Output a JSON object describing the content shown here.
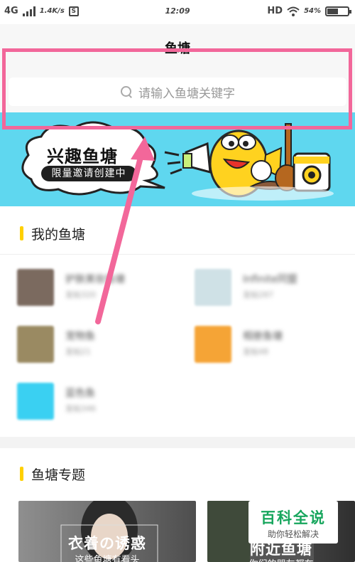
{
  "status_bar": {
    "network": "4G",
    "speed": "1.4K/s",
    "sim_icon": "S",
    "time": "12:09",
    "hd": "HD",
    "battery_text": "54%",
    "battery_level": 0.54
  },
  "header": {
    "title": "鱼塘",
    "search_placeholder": "请输入鱼塘关键字"
  },
  "banner": {
    "title": "兴趣鱼塘",
    "subtitle": "限量邀请创建中"
  },
  "my_ponds": {
    "heading": "我的鱼塘",
    "items": [
      {
        "name": "护肤美妆鱼塘",
        "meta": "发帖320",
        "thumb_color": "#7b6a5f"
      },
      {
        "name": "Infinite同盟",
        "meta": "发帖287",
        "thumb_color": "#cfe1e6"
      },
      {
        "name": "宠物鱼",
        "meta": "发帖21",
        "thumb_color": "#9a8a62"
      },
      {
        "name": "相册鱼塘",
        "meta": "发帖48",
        "thumb_color": "#f5a436"
      },
      {
        "name": "蓝色鱼",
        "meta": "发帖346",
        "thumb_color": "#3ad0f2"
      }
    ]
  },
  "topics": {
    "heading": "鱼塘专题",
    "items": [
      {
        "title": "衣着の诱惑",
        "subtitle": "这些鱼塘有看头"
      },
      {
        "title": "附近鱼塘",
        "subtitle": "你们的朋友都在"
      }
    ]
  },
  "watermark": {
    "title": "百科全说",
    "subtitle": "助你轻松解决"
  },
  "colors": {
    "annotation": "#f2679a",
    "accent_bar": "#ffd000",
    "banner_bg": "#5fd7ef",
    "watermark_green": "#17a65d"
  }
}
